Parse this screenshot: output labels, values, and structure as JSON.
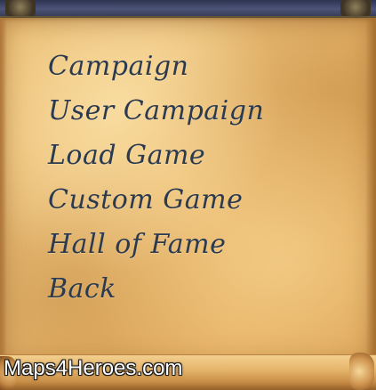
{
  "menu": {
    "items": [
      {
        "label": "Campaign"
      },
      {
        "label": "User Campaign"
      },
      {
        "label": "Load Game"
      },
      {
        "label": "Custom Game"
      },
      {
        "label": "Hall of Fame"
      },
      {
        "label": "Back"
      }
    ]
  },
  "watermark": {
    "text": "Maps4Heroes.com"
  },
  "colors": {
    "menu_text": "#2c3a50",
    "parchment": "#eabb6f",
    "frame": "#3a3f5a"
  }
}
